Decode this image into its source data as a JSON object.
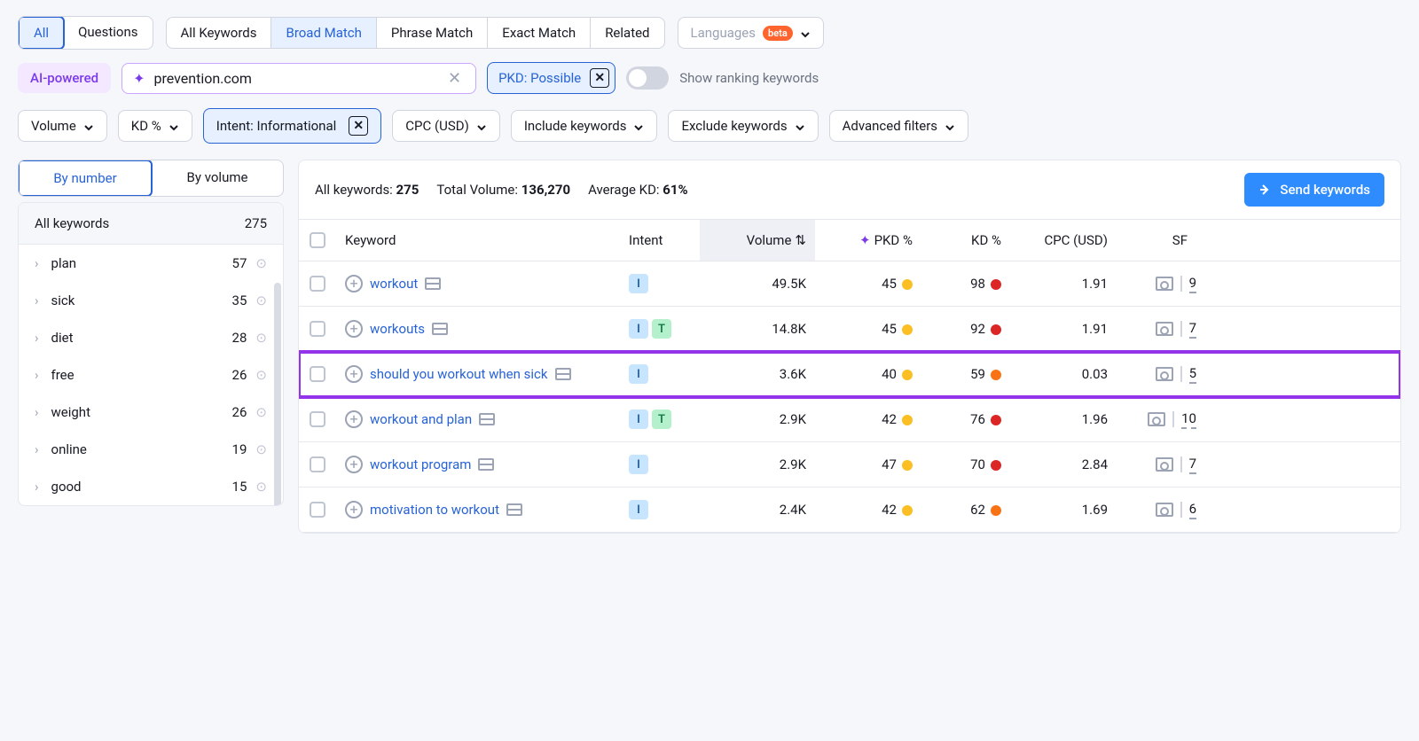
{
  "tabs1": {
    "all": "All",
    "questions": "Questions"
  },
  "tabs2": {
    "all_kw": "All Keywords",
    "broad": "Broad Match",
    "phrase": "Phrase Match",
    "exact": "Exact Match",
    "related": "Related"
  },
  "lang": {
    "label": "Languages",
    "badge": "beta"
  },
  "ai_label": "AI-powered",
  "domain_input": "prevention.com",
  "pkd_chip": "PKD: Possible",
  "toggle_label": "Show ranking keywords",
  "filters": {
    "volume": "Volume",
    "kd": "KD %",
    "intent": "Intent: Informational",
    "cpc": "CPC (USD)",
    "include": "Include keywords",
    "exclude": "Exclude keywords",
    "adv": "Advanced filters"
  },
  "view": {
    "num": "By number",
    "vol": "By volume"
  },
  "sidebar": {
    "head_label": "All keywords",
    "head_count": "275",
    "items": [
      {
        "label": "plan",
        "count": "57"
      },
      {
        "label": "sick",
        "count": "35"
      },
      {
        "label": "diet",
        "count": "28"
      },
      {
        "label": "free",
        "count": "26"
      },
      {
        "label": "weight",
        "count": "26"
      },
      {
        "label": "online",
        "count": "19"
      },
      {
        "label": "good",
        "count": "15"
      }
    ]
  },
  "stats": {
    "all_lbl": "All keywords: ",
    "all_v": "275",
    "tv_lbl": "Total Volume: ",
    "tv_v": "136,270",
    "akd_lbl": "Average KD: ",
    "akd_v": "61%"
  },
  "send_btn": "Send keywords",
  "cols": {
    "kw": "Keyword",
    "intent": "Intent",
    "vol": "Volume",
    "pkd": "PKD %",
    "kd": "KD %",
    "cpc": "CPC (USD)",
    "sf": "SF"
  },
  "rows": [
    {
      "kw": "workout",
      "intents": [
        "I"
      ],
      "vol": "49.5K",
      "pkd": "45",
      "pkd_c": "yellow",
      "kd": "98",
      "kd_c": "red",
      "cpc": "1.91",
      "sf": "9",
      "hl": false
    },
    {
      "kw": "workouts",
      "intents": [
        "I",
        "T"
      ],
      "vol": "14.8K",
      "pkd": "45",
      "pkd_c": "yellow",
      "kd": "92",
      "kd_c": "red",
      "cpc": "1.91",
      "sf": "7",
      "hl": false
    },
    {
      "kw": "should you workout when sick",
      "intents": [
        "I"
      ],
      "vol": "3.6K",
      "pkd": "40",
      "pkd_c": "yellow",
      "kd": "59",
      "kd_c": "orange",
      "cpc": "0.03",
      "sf": "5",
      "hl": true
    },
    {
      "kw": "workout and plan",
      "intents": [
        "I",
        "T"
      ],
      "vol": "2.9K",
      "pkd": "42",
      "pkd_c": "yellow",
      "kd": "76",
      "kd_c": "red",
      "cpc": "1.96",
      "sf": "10",
      "hl": false
    },
    {
      "kw": "workout program",
      "intents": [
        "I"
      ],
      "vol": "2.9K",
      "pkd": "47",
      "pkd_c": "yellow",
      "kd": "70",
      "kd_c": "red",
      "cpc": "2.84",
      "sf": "7",
      "hl": false
    },
    {
      "kw": "motivation to workout",
      "intents": [
        "I"
      ],
      "vol": "2.4K",
      "pkd": "42",
      "pkd_c": "yellow",
      "kd": "62",
      "kd_c": "orange",
      "cpc": "1.69",
      "sf": "6",
      "hl": false
    }
  ]
}
